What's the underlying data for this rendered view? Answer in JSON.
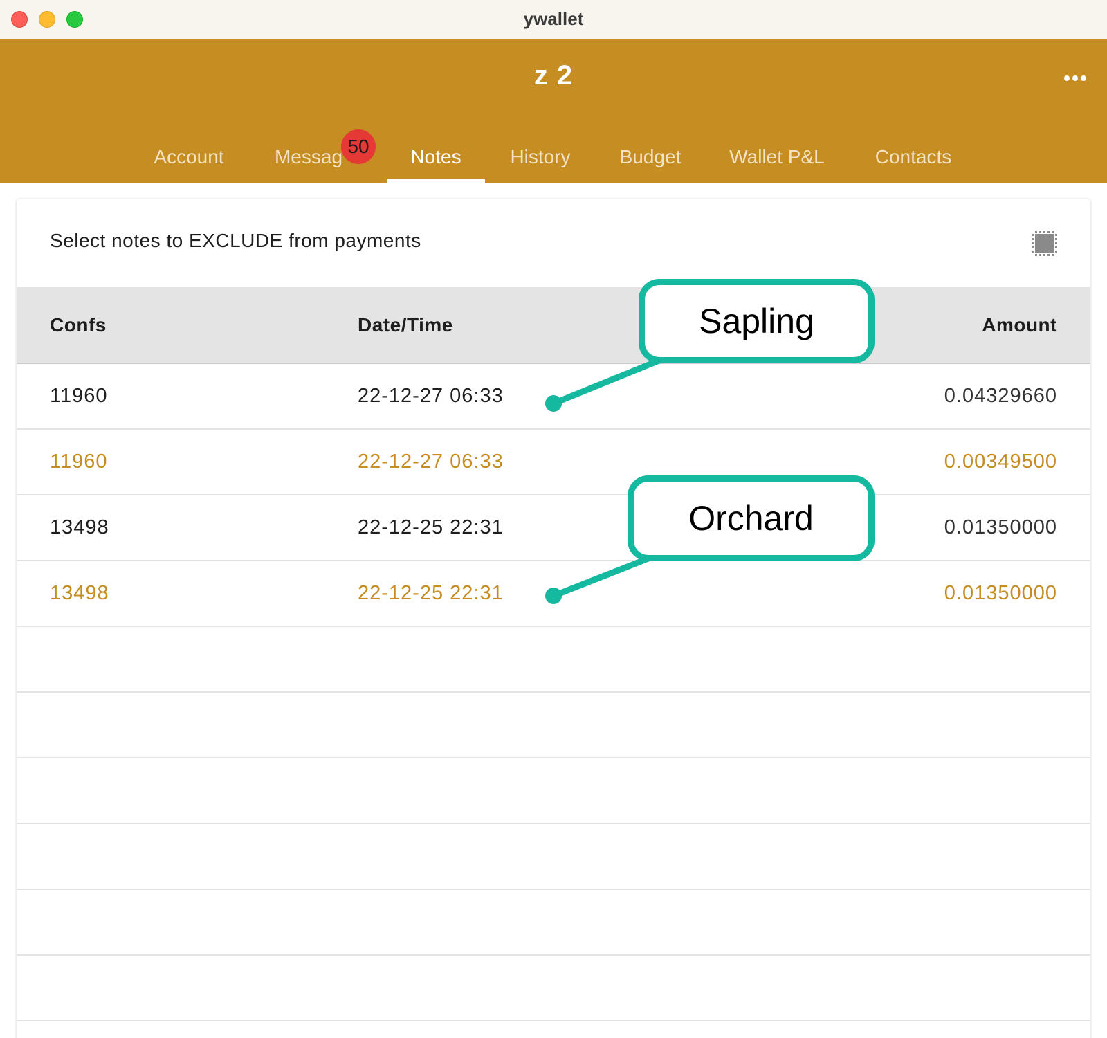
{
  "window": {
    "title": "ywallet"
  },
  "appbar": {
    "account_name": "z 2"
  },
  "tabs": [
    {
      "label": "Account"
    },
    {
      "label": "Messag",
      "badge": "50"
    },
    {
      "label": "Notes",
      "active": true
    },
    {
      "label": "History"
    },
    {
      "label": "Budget"
    },
    {
      "label": "Wallet P&L"
    },
    {
      "label": "Contacts"
    }
  ],
  "notes_card": {
    "title": "Select notes to EXCLUDE from payments",
    "columns": {
      "confs": "Confs",
      "datetime": "Date/Time",
      "amount": "Amount"
    },
    "rows": [
      {
        "confs": "11960",
        "datetime": "22-12-27 06:33",
        "amount": "0.04329660",
        "excluded": false
      },
      {
        "confs": "11960",
        "datetime": "22-12-27 06:33",
        "amount": "0.00349500",
        "excluded": true
      },
      {
        "confs": "13498",
        "datetime": "22-12-25 22:31",
        "amount": "0.01350000",
        "excluded": false
      },
      {
        "confs": "13498",
        "datetime": "22-12-25 22:31",
        "amount": "0.01350000",
        "excluded": true
      }
    ]
  },
  "annotations": {
    "sapling": "Sapling",
    "orchard": "Orchard"
  },
  "colors": {
    "appbar": "#c68d22",
    "excluded_text": "#c68d22",
    "badge": "#e53935",
    "annotation": "#14b9a0"
  },
  "icons": {
    "more": "more-horizontal-icon",
    "select_all": "select-all-icon"
  }
}
